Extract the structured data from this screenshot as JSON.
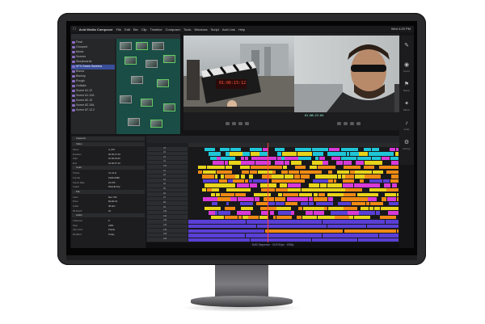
{
  "menubar": {
    "app_name": "Avid Media Composer",
    "items": [
      "File",
      "Edit",
      "Bin",
      "Clip",
      "Timeline",
      "Composer",
      "Tools",
      "Windows",
      "Script",
      "Avid Link",
      "Help"
    ],
    "clock": "Wed 4:20 PM"
  },
  "bin": {
    "tree": [
      "Final",
      "Grouped",
      "Music",
      "Scenes",
      "Storyboards",
      "VFX Green Screens",
      "Bonus",
      "Backup",
      "Rough",
      "Outtake",
      "Scene 61.12",
      "Scene 61.12A",
      "Scene 82.15",
      "Scene 82.15A",
      "Scene 87.12.2"
    ],
    "selected_index": 5
  },
  "monitors": {
    "source_timecode": "01:06:15:12",
    "record_timecode": "01:08:22:04"
  },
  "palette": {
    "items": [
      {
        "icon": "pencil-icon",
        "label": ""
      },
      {
        "icon": "eye-icon",
        "label": "Source"
      },
      {
        "icon": "flag-icon",
        "label": "Marker"
      },
      {
        "icon": "effect-icon",
        "label": "Effects"
      },
      {
        "icon": "audio-icon",
        "label": "Audio"
      },
      {
        "icon": "gear-icon",
        "label": "Settings"
      }
    ]
  },
  "inspector": {
    "header": "Inspector",
    "sections": [
      "Video",
      "Color",
      "File",
      "Audio",
      "Clip"
    ],
    "rows": [
      [
        "Name",
        "A_001"
      ],
      [
        "Duration",
        "00:00:27:16"
      ],
      [
        "Start",
        "01:06:10:00"
      ],
      [
        "End",
        "01:06:37:16"
      ],
      [
        "Tracks",
        "V1 A1-8"
      ],
      [
        "Format",
        "1920x1080"
      ],
      [
        "Frame Rate",
        "23.976"
      ],
      [
        "Codec",
        "DNxHR HQ"
      ],
      [
        "Color",
        "Rec.709"
      ],
      [
        "Drive",
        "Media 01"
      ],
      [
        "Audio",
        "48 kHz"
      ],
      [
        "Bit Depth",
        "24"
      ],
      [
        "Channels",
        "8"
      ],
      [
        "Tape",
        "A001"
      ],
      [
        "Clip Color",
        "Purple"
      ],
      [
        "Modified",
        "Today"
      ]
    ]
  },
  "timeline": {
    "tracks": [
      "V4",
      "V3",
      "V2",
      "V1",
      "TC1",
      "A1",
      "A2",
      "A3",
      "A4",
      "A5",
      "A6",
      "A7",
      "A8",
      "A9",
      "A10",
      "A11",
      "A12",
      "A13",
      "A14",
      "A15",
      "A16"
    ],
    "status_text": "AVID Sequence · 23.976 fps · 1080p"
  },
  "colors": {
    "accent": "#8a6cc2",
    "teal": "#1a4d45",
    "track_yellow": "#e8d41a",
    "track_orange": "#f08a14",
    "track_purple": "#5a3fd6",
    "track_magenta": "#d83ad8",
    "track_cyan": "#1ec6d8"
  }
}
